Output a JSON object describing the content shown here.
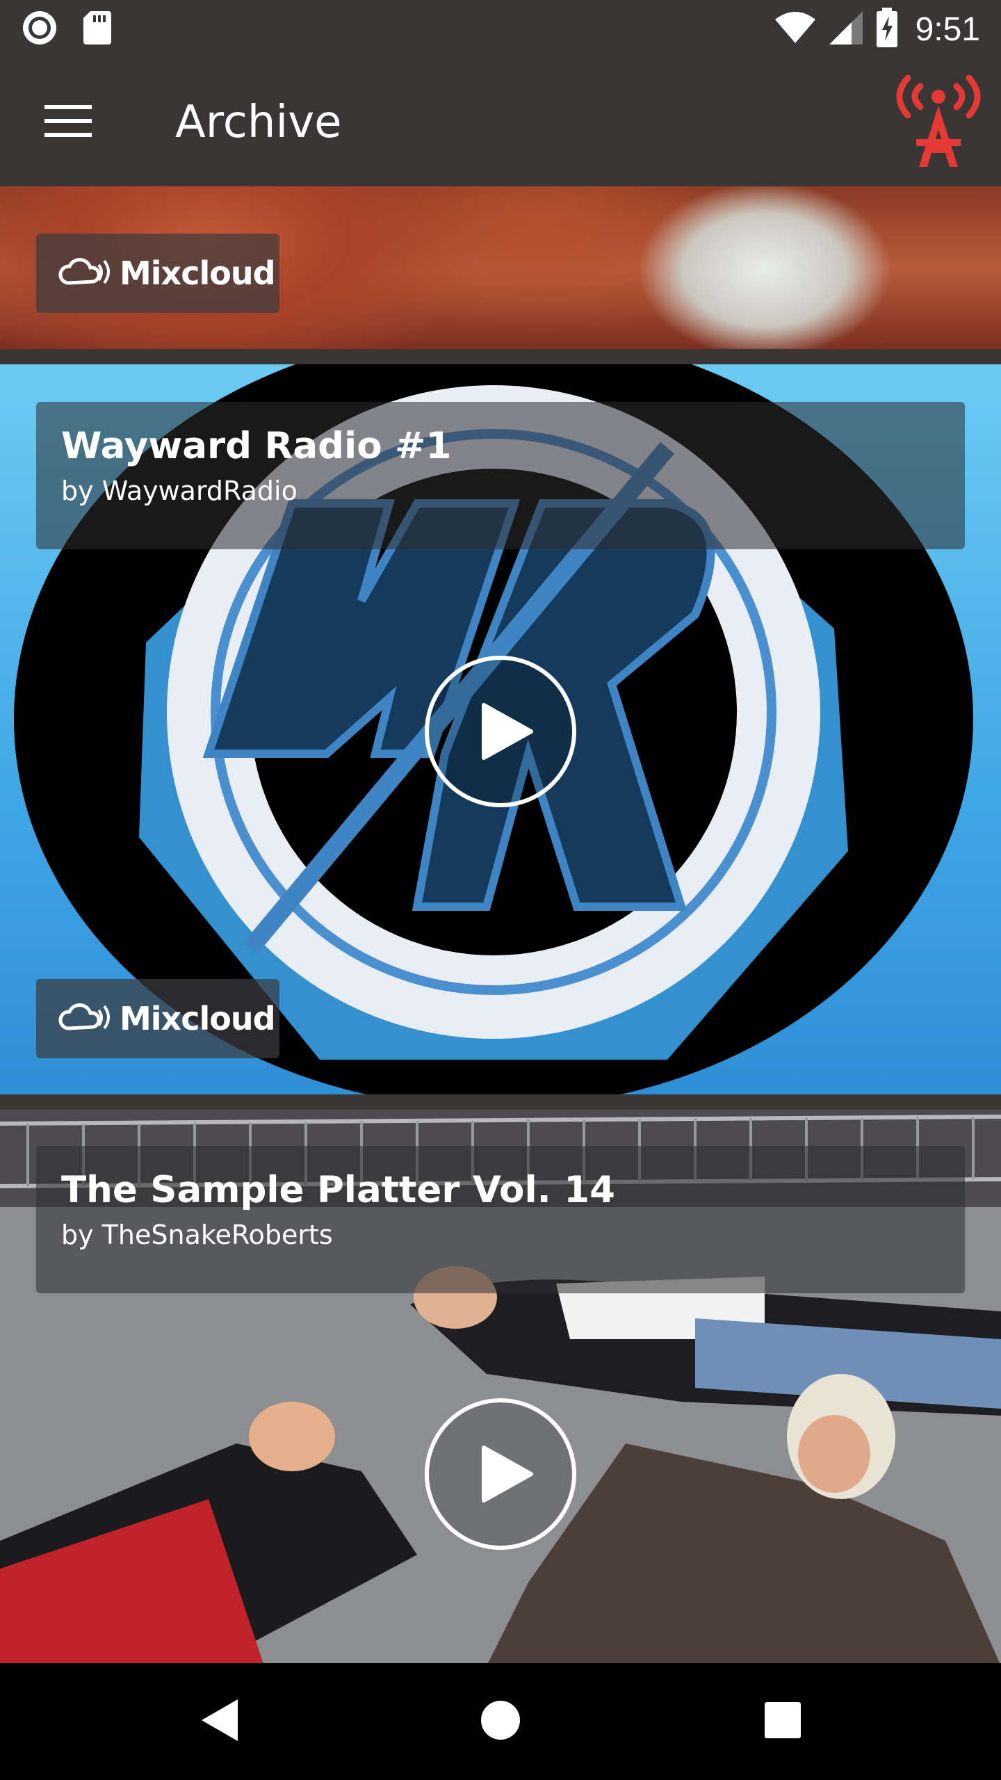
{
  "status_bar": {
    "time": "9:51",
    "left_icons": [
      "record-icon",
      "sd-card-icon"
    ],
    "right_icons": [
      "wifi-icon",
      "cell-signal-icon",
      "battery-charging-icon"
    ]
  },
  "app_bar": {
    "title": "Archive",
    "menu_icon": "hamburger-menu-icon",
    "action_icon": "radio-antenna-icon",
    "accent_color": "#e53935"
  },
  "feed": {
    "items": [
      {
        "title": "",
        "author": "",
        "source": "Mixcloud"
      },
      {
        "title": "Wayward Radio #1",
        "author": "by WaywardRadio",
        "source": "Mixcloud"
      },
      {
        "title": "The Sample Platter Vol. 14",
        "author": "by TheSnakeRoberts",
        "source": ""
      }
    ]
  },
  "nav_bar": {
    "back": "back-triangle-icon",
    "home": "home-circle-icon",
    "recents": "recents-square-icon"
  }
}
